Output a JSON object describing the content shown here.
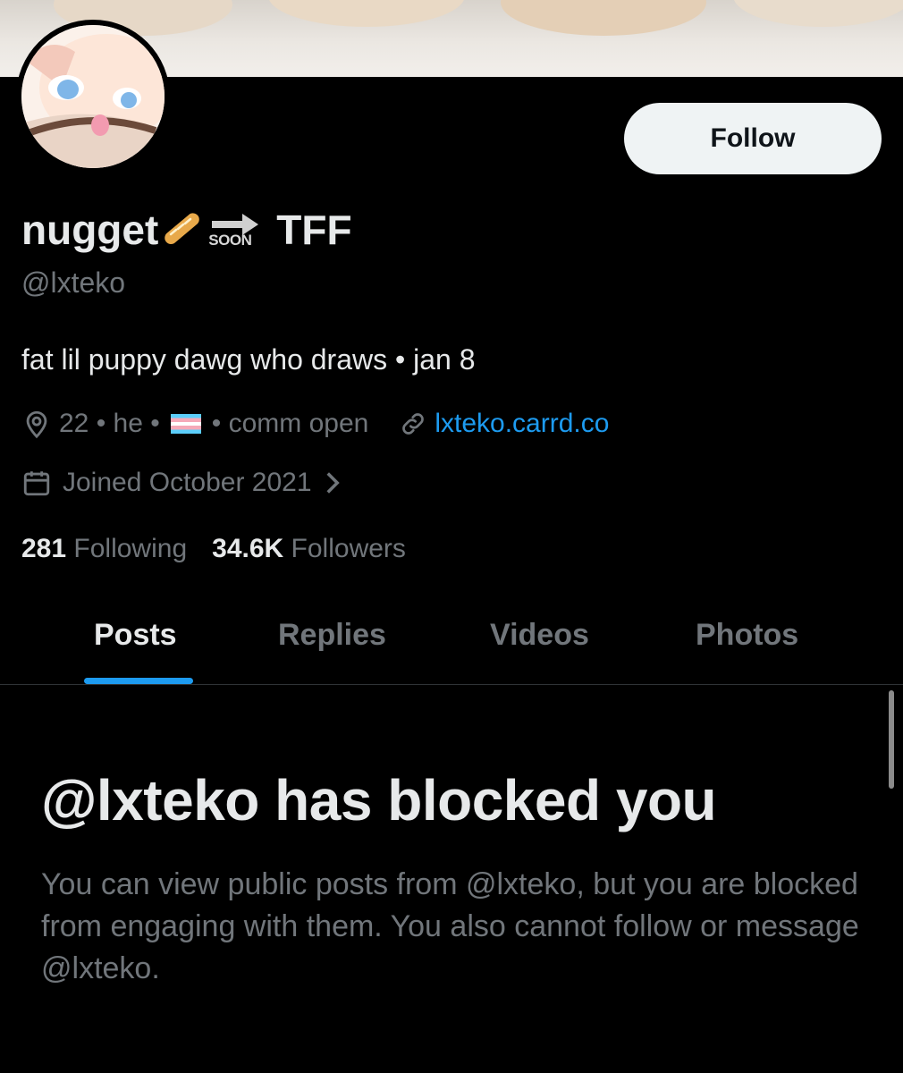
{
  "profile": {
    "display_name": "nugget",
    "name_emoji": "baguette-bread-emoji",
    "soon_label": "SOON",
    "name_suffix": "TFF",
    "handle": "@lxteko",
    "bio": "fat lil puppy dawg who draws • jan 8",
    "location": "22 • he •",
    "location_after_flag": "• comm open",
    "website": "lxteko.carrd.co",
    "joined": "Joined October 2021",
    "following_count": "281",
    "following_label": "Following",
    "followers_count": "34.6K",
    "followers_label": "Followers"
  },
  "actions": {
    "follow_label": "Follow"
  },
  "tabs": [
    {
      "label": "Posts",
      "active": true
    },
    {
      "label": "Replies",
      "active": false
    },
    {
      "label": "Videos",
      "active": false
    },
    {
      "label": "Photos",
      "active": false
    }
  ],
  "blocked": {
    "title": "@lxteko has blocked you",
    "body": "You can view public posts from @lxteko, but you are blocked from engaging with them. You also cannot follow or message @lxteko."
  },
  "colors": {
    "background": "#000000",
    "text_primary": "#e7e9ea",
    "text_secondary": "#71767b",
    "accent": "#1d9bf0",
    "follow_button_bg": "#eff3f4"
  },
  "icons": [
    "location-pin-icon",
    "trans-flag-emoji",
    "link-icon",
    "calendar-icon",
    "chevron-right-icon",
    "right-arrow-emoji"
  ]
}
